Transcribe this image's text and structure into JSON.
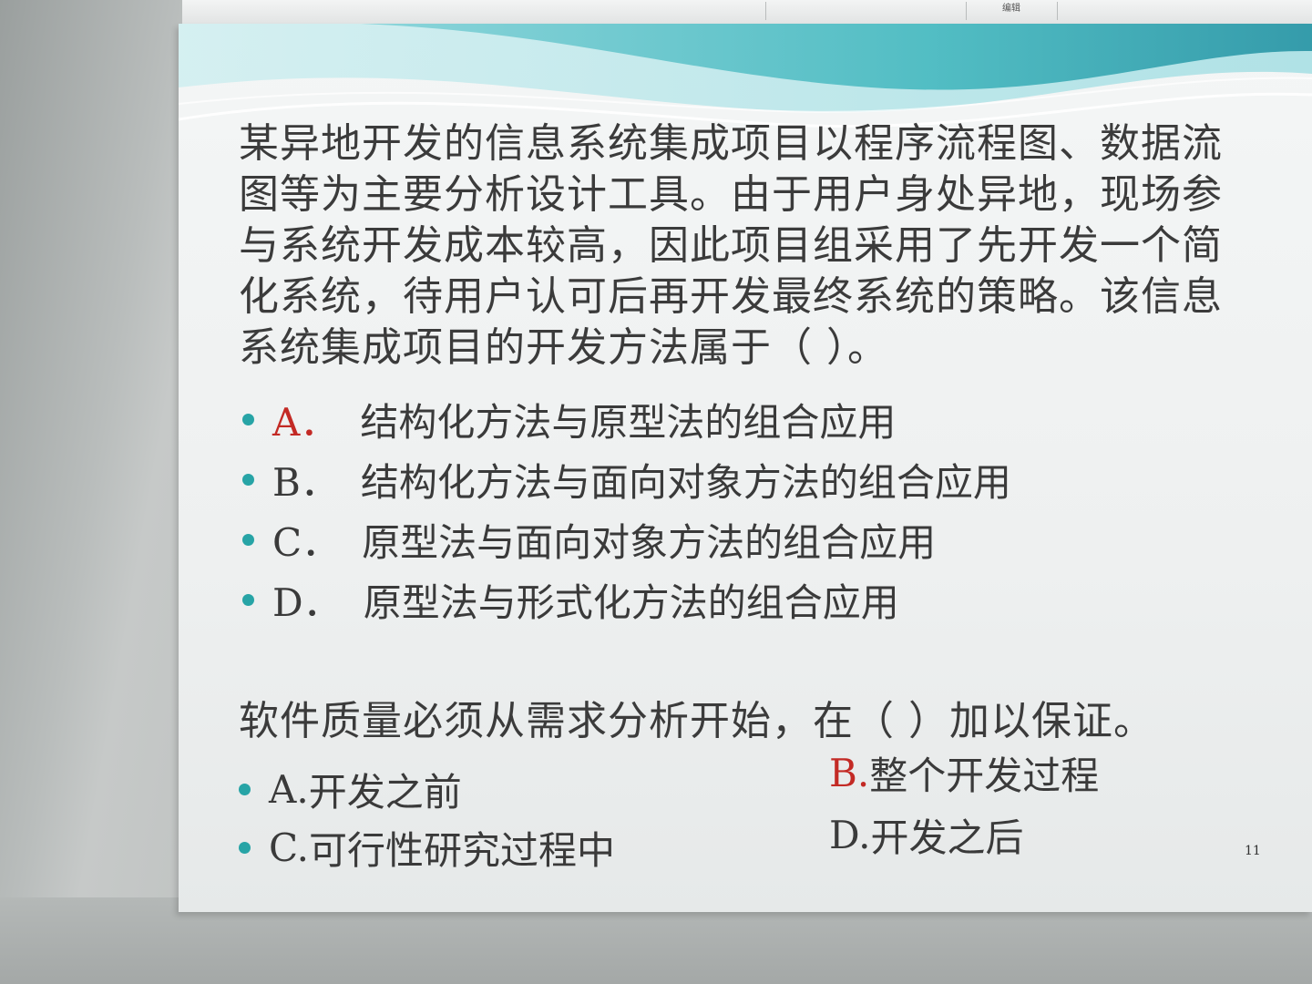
{
  "ribbon": {
    "label": "编辑"
  },
  "slide": {
    "page_number": "11",
    "q1": {
      "text": "某异地开发的信息系统集成项目以程序流程图、数据流图等为主要分析设计工具。由于用户身处异地，现场参与系统开发成本较高，因此项目组采用了先开发一个简化系统，待用户认可后再开发最终系统的策略。该信息系统集成项目的开发方法属于（   ）。",
      "options": [
        {
          "letter": "A．",
          "text": "结构化方法与原型法的组合应用",
          "highlight": true
        },
        {
          "letter": "B．",
          "text": "结构化方法与面向对象方法的组合应用",
          "highlight": false
        },
        {
          "letter": "C．",
          "text": "原型法与面向对象方法的组合应用",
          "highlight": false
        },
        {
          "letter": "D．",
          "text": "原型法与形式化方法的组合应用",
          "highlight": false
        }
      ]
    },
    "q2": {
      "text": "软件质量必须从需求分析开始，在（   ）加以保证。",
      "options": [
        {
          "letter": "A.",
          "text": " 开发之前",
          "highlight": false
        },
        {
          "letter": "B.",
          "text": " 整个开发过程",
          "highlight": true
        },
        {
          "letter": "C.",
          "text": " 可行性研究过程中",
          "highlight": false
        },
        {
          "letter": "D.",
          "text": " 开发之后",
          "highlight": false
        }
      ]
    },
    "colors": {
      "bullet": "#27a4a6",
      "answer_red": "#c32a25",
      "text": "#3a3a3a",
      "wave_teal": "#3fb6bd"
    }
  }
}
